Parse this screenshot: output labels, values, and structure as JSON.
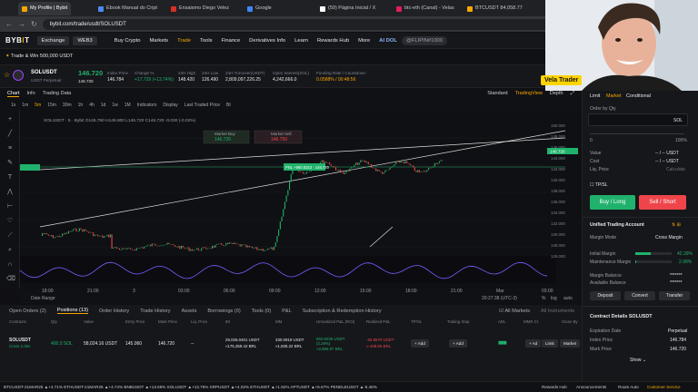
{
  "browser": {
    "tabs": [
      {
        "label": "My Profile | Bybit",
        "color": "#f7a600"
      },
      {
        "label": "Ebook Manual do Cript",
        "color": "#4a8af4"
      },
      {
        "label": "Ensaismo Diego Velez",
        "color": "#d93025"
      },
      {
        "label": "Google",
        "color": "#4285f4"
      },
      {
        "label": "(59) Página Inicial / X",
        "color": "#ffffff"
      },
      {
        "label": "btc-eth (Canal) - Velas",
        "color": "#e01e5a"
      },
      {
        "label": "BTCUSDT 84,058.77",
        "color": "#f7a600"
      }
    ],
    "url": "bybit.com/trade/usdt/SOLUSDT"
  },
  "nav": {
    "logo_a": "BYB",
    "logo_b": "I",
    "logo_c": "T",
    "exchange": "Exchange",
    "web3": "WEB3",
    "items": [
      "Buy Crypto",
      "Markets",
      "Trade",
      "Tools",
      "Finance",
      "Derivatives Info",
      "Learn",
      "Rewards Hub",
      "More"
    ],
    "tag": "AI DOL",
    "profile": "@FLIPIN#1000"
  },
  "promo": "Trade & Win 500,000 USDT",
  "ticker": {
    "symbol": "SOLUSDT",
    "sub": "USDT Perpetual",
    "price": "146.720",
    "sub_price": "146.720",
    "stats": [
      {
        "label": "Index Price",
        "value": "146.784"
      },
      {
        "label": "Change %",
        "value": "+17.729 (+13.74%)"
      },
      {
        "label": "24H High",
        "value": "148.420"
      },
      {
        "label": "24H Low",
        "value": "126.490"
      },
      {
        "label": "24H Turnover(USDT)",
        "value": "2,809,097,226.25"
      },
      {
        "label": "Open Interest(SOL)",
        "value": "4,242,666.0"
      },
      {
        "label": "Funding Rate / Countdown",
        "value": "0.0588% / 00:48:56"
      }
    ]
  },
  "chart": {
    "tabs": [
      "Chart",
      "Info",
      "Trading Data"
    ],
    "views": [
      "Standard",
      "TradingView",
      "Depth"
    ],
    "intervals": [
      "1s",
      "1m",
      "5m",
      "15m",
      "30m",
      "1h",
      "4h",
      "1d",
      "1w",
      "1M"
    ],
    "tools": [
      "Indicators",
      "Display",
      "Last Traded Price",
      "Bt"
    ],
    "ohlc": "SOLUSDT · 5 · Bybit  O146.750 H146.800 L146.720 C146.720 -0.030 (-0.02%)",
    "market_buy_label": "Market Buy",
    "market_buy": "146.720",
    "market_sell_label": "Market Sell",
    "market_sell": "146.750",
    "yaxis": [
      "150.000",
      "148.000",
      "146.000",
      "144.000",
      "142.000",
      "140.000",
      "138.000",
      "136.000",
      "134.000",
      "132.000",
      "130.000",
      "128.000",
      "126.000"
    ],
    "xaxis": [
      "18:00",
      "21:00",
      "3",
      "03:00",
      "06:00",
      "09:00",
      "12:00",
      "15:00",
      "18:00",
      "21:00",
      "Mar",
      "03:00"
    ],
    "position_label": "PNL +960.8153 · 146.720",
    "price_tag": "146.720",
    "date_range": "Date Range",
    "clock": "20:27:38 (UTC-3)",
    "footer_opts": [
      "%",
      "log",
      "auto"
    ]
  },
  "positions": {
    "tabs": [
      "Open Orders (2)",
      "Positions (13)",
      "Order History",
      "Trade History",
      "Assets",
      "Borrowings (0)",
      "Tools (0)",
      "P&L",
      "Subscription & Redemption History"
    ],
    "all_markets": "All Markets",
    "all_instruments": "All Instruments",
    "headers": [
      "Contracts",
      "Qty",
      "Value",
      "Entry Price",
      "Mark Price",
      "Liq. Price",
      "IM",
      "MM",
      "Unrealized P&L (ROI)",
      "Realized P&L",
      "TP/SL",
      "Trailing Stop",
      "ADL",
      "MMR Cl.",
      "Close By"
    ],
    "row": {
      "contract": "SOLUSDT",
      "mode": "Cross 2.00x",
      "qty": "400.0 SOL",
      "value": "58,024.16 USDT",
      "entry": "145.060",
      "mark": "146.720",
      "liq": "--",
      "im": "29,026.0401 USDT",
      "im2": "≈175,359.42 BRL",
      "mm": "330.0919 USDT",
      "mm2": "≈1,835.22 BRL",
      "upnl": "663.8236 USDT (2.29%)",
      "upnl2": "≈3,958.97 BRL",
      "rpnl": "-33.8670 USDT",
      "rpnl2": "≈-108.65 BRL",
      "add": "+ Add",
      "add2": "+ Add",
      "limit": "Limit",
      "market": "Market"
    }
  },
  "order_panel": {
    "tabs": [
      "Limit",
      "Market",
      "Conditional"
    ],
    "order_by": "Order by Qty",
    "unit": "SOL",
    "pct_left": "0",
    "pct_right": "100%",
    "value_label": "Value",
    "value": "-- / -- USDT",
    "cost_label": "Cost",
    "cost": "-- / -- USDT",
    "liq_label": "Liq. Price",
    "liq": "Calculate",
    "tpsl": "TP/SL",
    "buy": "Buy / Long",
    "sell": "Sell / Short",
    "uta": "Unified Trading Account",
    "margin_mode_label": "Margin Mode",
    "margin_mode": "Cross Margin",
    "im_label": "Initial Margin",
    "im": "42.39%",
    "mm_label": "Maintenance Margin",
    "mm": "2.98%",
    "mb_label": "Margin Balance",
    "mb": "*******",
    "ab_label": "Available Balance",
    "ab": "*******",
    "deposit": "Deposit",
    "convert": "Convert",
    "transfer": "Transfer",
    "cd_title": "Contract Details SOLUSDT",
    "exp_label": "Expiration Date",
    "exp": "Perpetual",
    "idx_label": "Index Price",
    "idx": "146.784",
    "mark_label": "Mark Price",
    "mark": "146.720",
    "show": "Show"
  },
  "bottom_ticker": "BTCUSDT-21MAR25 ▲+4.71%   ETHUSDT-21MAR25 ▲+4.74%   BNBUSDT ▲+13.65%   SOLUSDT ▲+13.75%   XRPUSDT ▲+4.02%   ETHUSDT ▲+1.52%   APTUSDT ▲+5.67%   PENDLEUSDT ▲-5.46%",
  "bottom_right": [
    "Rewards Hub",
    "Announcements",
    "Route Auto",
    "Customer Service"
  ],
  "webcam_label": "Vela Trader"
}
